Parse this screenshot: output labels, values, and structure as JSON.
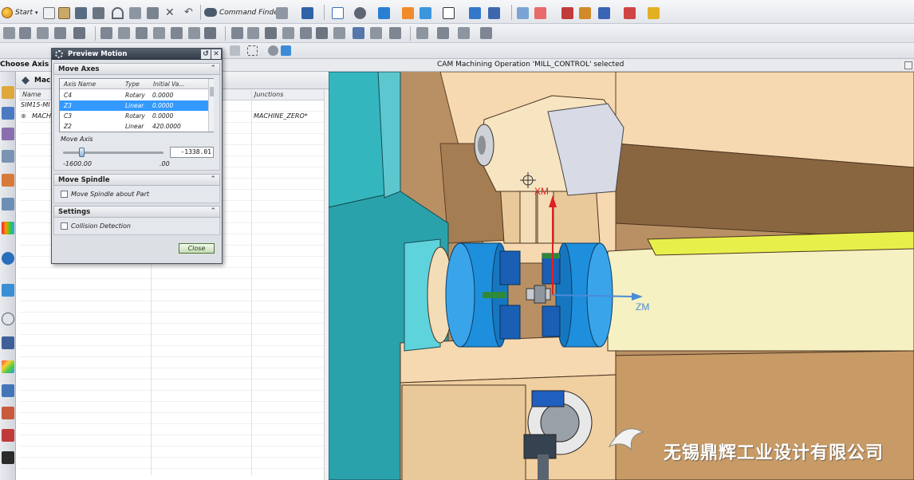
{
  "toolbar": {
    "start_label": "Start",
    "command_finder_label": "Command Finder"
  },
  "cue_line": {
    "prompt": "Choose Axis Na",
    "status": "CAM Machining Operation 'MILL_CONTROL' selected"
  },
  "navigator": {
    "title": "Mach",
    "columns": [
      "Name",
      "Junctions"
    ],
    "rows": [
      {
        "name": "SIM15-MI",
        "junction": ""
      },
      {
        "name": "MACH",
        "junction": "MACHINE_ZERO*"
      }
    ]
  },
  "dialog": {
    "title": "Preview Motion",
    "move_axes": {
      "header": "Move Axes",
      "columns": [
        "Axis Name",
        "Type",
        "Initial Va..."
      ],
      "rows": [
        {
          "axis": "C4",
          "type": "Rotary",
          "initial": "0.0000",
          "selected": false
        },
        {
          "axis": "Z3",
          "type": "Linear",
          "initial": "0.0000",
          "selected": true
        },
        {
          "axis": "C3",
          "type": "Rotary",
          "initial": "0.0000",
          "selected": false
        },
        {
          "axis": "Z2",
          "type": "Linear",
          "initial": "420.0000",
          "selected": false
        }
      ],
      "move_axis_label": "Move Axis",
      "value": "-1338.01",
      "slider_min": "-1600.00",
      "slider_max": ".00"
    },
    "move_spindle": {
      "header": "Move Spindle",
      "checkbox_label": "Move Spindle about Part",
      "checked": false
    },
    "settings": {
      "header": "Settings",
      "checkbox_label": "Collision Detection",
      "checked": false
    },
    "close_label": "Close"
  },
  "viewport": {
    "axis_labels": {
      "x": "XM",
      "z": "ZM"
    },
    "watermark": "无锡鼎辉工业设计有限公司"
  },
  "colors": {
    "selection": "#3399ff",
    "teal_housing": "#34b6bf",
    "chuck_blue": "#1e8fdc",
    "beige": "#f6d9b0",
    "dark_wood": "#8a6640",
    "spindle_cream": "#f6f1c2",
    "yellow_green": "#e7f04a"
  }
}
